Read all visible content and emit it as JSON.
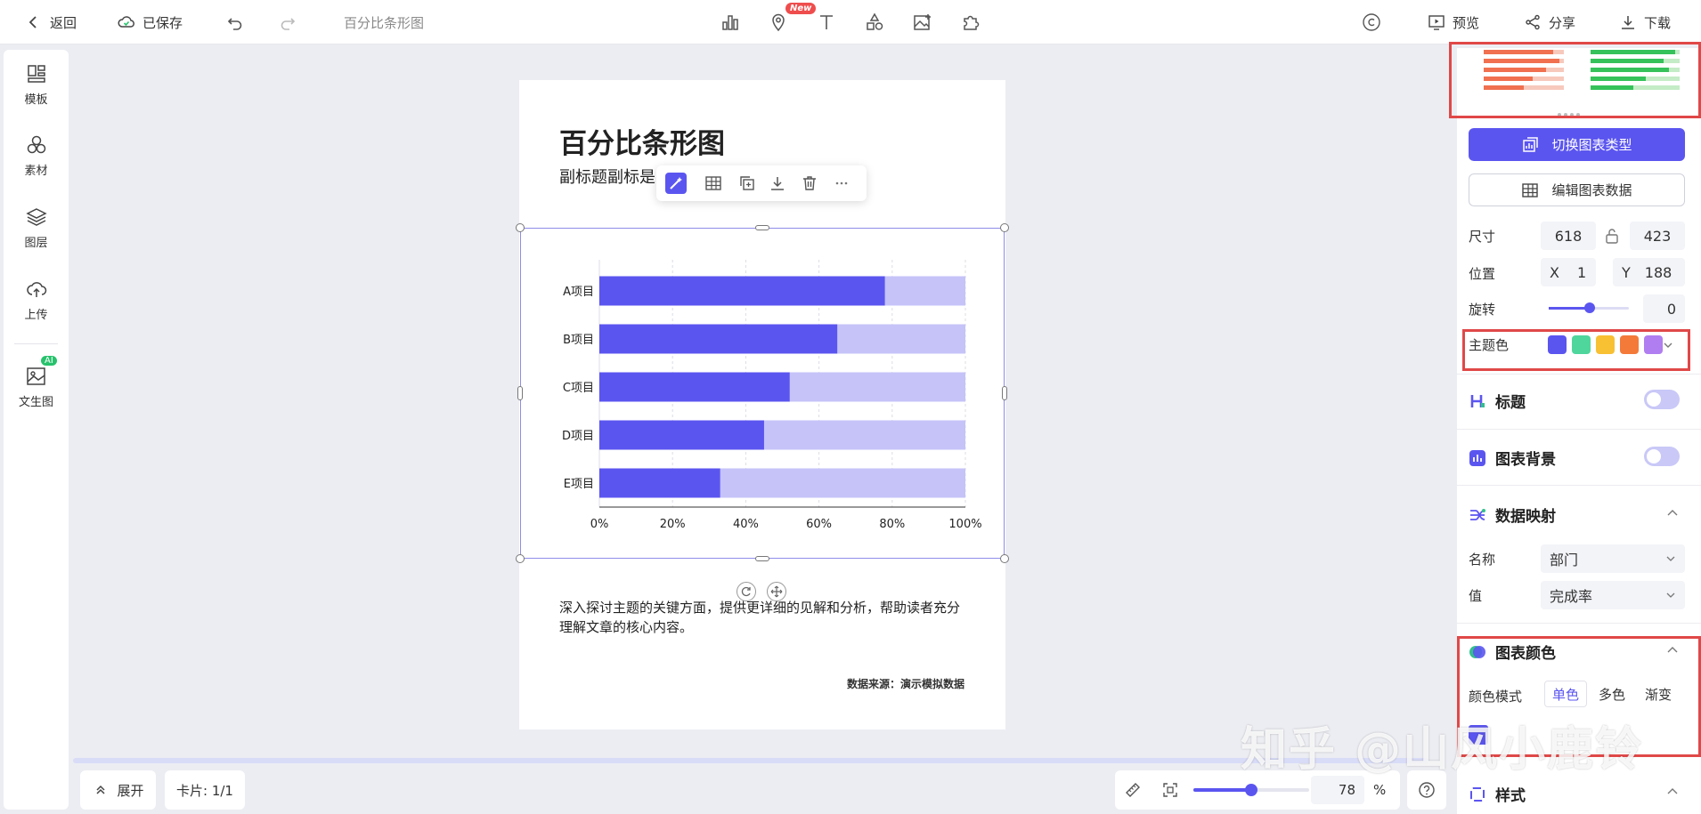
{
  "topbar": {
    "back_label": "返回",
    "saved_label": "已保存",
    "doc_title": "百分比条形图",
    "new_badge": "New",
    "preview_label": "预览",
    "share_label": "分享",
    "download_label": "下载"
  },
  "sidebar": {
    "items": [
      {
        "label": "模板"
      },
      {
        "label": "素材"
      },
      {
        "label": "图层"
      },
      {
        "label": "上传"
      },
      {
        "label": "文生图"
      }
    ],
    "ai_badge": "AI"
  },
  "card": {
    "title": "百分比条形图",
    "subtitle": "副标题副标是",
    "description": "深入探讨主题的关键方面，提供更详细的见解和分析，帮助读者充分理解文章的核心内容。",
    "source": "数据来源：演示模拟数据"
  },
  "chart_data": {
    "type": "bar",
    "orientation": "horizontal",
    "stacked_percent": true,
    "categories": [
      "A项目",
      "B项目",
      "C项目",
      "D项目",
      "E项目"
    ],
    "values": [
      78,
      65,
      52,
      45,
      33
    ],
    "xlim": [
      0,
      100
    ],
    "xticks": [
      "0%",
      "20%",
      "40%",
      "60%",
      "80%",
      "100%"
    ],
    "colors": {
      "bar": "#5b55f0",
      "track": "#c5c3f8"
    },
    "grid": true
  },
  "bottombar": {
    "expand_label": "展开",
    "card_label": "卡片: 1/1",
    "zoom_value": "78",
    "zoom_unit": "%",
    "zoom_level": 0.5
  },
  "rightpanel": {
    "switch_type_label": "切换图表类型",
    "edit_data_label": "编辑图表数据",
    "size_label": "尺寸",
    "width": "618",
    "height": "423",
    "position_label": "位置",
    "x_label": "X",
    "x_value": "1",
    "y_label": "Y",
    "y_value": "188",
    "rotate_label": "旋转",
    "rotate_value": "0",
    "theme_label": "主题色",
    "theme_colors": [
      "#5b55f0",
      "#4fd69c",
      "#f8c033",
      "#f47a3a",
      "#b07ef0"
    ],
    "title_section": "标题",
    "bg_section": "图表背景",
    "mapping_section": "数据映射",
    "name_label": "名称",
    "name_value": "部门",
    "value_label": "值",
    "value_value": "完成率",
    "color_section": "图表颜色",
    "color_mode_label": "颜色模式",
    "modes": [
      "单色",
      "多色",
      "渐变"
    ],
    "style_section": "样式"
  },
  "watermark": "知乎 @山风小鹿铃"
}
